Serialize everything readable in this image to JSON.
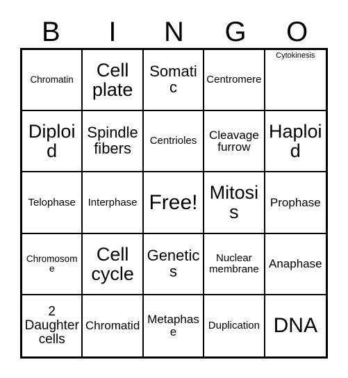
{
  "header": {
    "letters": [
      "B",
      "I",
      "N",
      "G",
      "O"
    ]
  },
  "colors": {
    "background": "#ffffff",
    "border": "#000000",
    "text": "#000000"
  },
  "grid": {
    "rows": 5,
    "columns": 5,
    "cells": [
      [
        {
          "label": "Chromatin",
          "size": "fs-s",
          "align": "middle"
        },
        {
          "label": "Cell plate",
          "size": "fs-xxl",
          "align": "middle"
        },
        {
          "label": "Somatic",
          "size": "fs-xl",
          "align": "middle"
        },
        {
          "label": "Centromere",
          "size": "fs-m",
          "align": "middle"
        },
        {
          "label": "Cytokinesis",
          "size": "fs-xs",
          "align": "top"
        }
      ],
      [
        {
          "label": "Diploid",
          "size": "fs-xxl",
          "align": "middle"
        },
        {
          "label": "Spindle fibers",
          "size": "fs-xl",
          "align": "middle"
        },
        {
          "label": "Centrioles",
          "size": "fs-m",
          "align": "middle"
        },
        {
          "label": "Cleavage furrow",
          "size": "fs-ml",
          "align": "middle"
        },
        {
          "label": "Haploid",
          "size": "fs-xxl",
          "align": "middle"
        }
      ],
      [
        {
          "label": "Telophase",
          "size": "fs-m",
          "align": "middle"
        },
        {
          "label": "Interphase",
          "size": "fs-m",
          "align": "middle"
        },
        {
          "label": "Free!",
          "size": "fs-huge",
          "align": "middle"
        },
        {
          "label": "Mitosis",
          "size": "fs-xxl",
          "align": "middle"
        },
        {
          "label": "Prophase",
          "size": "fs-ml",
          "align": "middle"
        }
      ],
      [
        {
          "label": "Chromosome",
          "size": "fs-s",
          "align": "middle"
        },
        {
          "label": "Cell cycle",
          "size": "fs-xxl",
          "align": "middle"
        },
        {
          "label": "Genetics",
          "size": "fs-xl",
          "align": "middle"
        },
        {
          "label": "Nuclear membrane",
          "size": "fs-m",
          "align": "middle"
        },
        {
          "label": "Anaphase",
          "size": "fs-ml",
          "align": "middle"
        }
      ],
      [
        {
          "label": "2 Daughter cells",
          "size": "fs-l",
          "align": "middle"
        },
        {
          "label": "Chromatid",
          "size": "fs-ml",
          "align": "middle"
        },
        {
          "label": "Metaphase",
          "size": "fs-ml",
          "align": "middle"
        },
        {
          "label": "Duplication",
          "size": "fs-m",
          "align": "middle"
        },
        {
          "label": "DNA",
          "size": "fs-huge",
          "align": "middle"
        }
      ]
    ]
  }
}
